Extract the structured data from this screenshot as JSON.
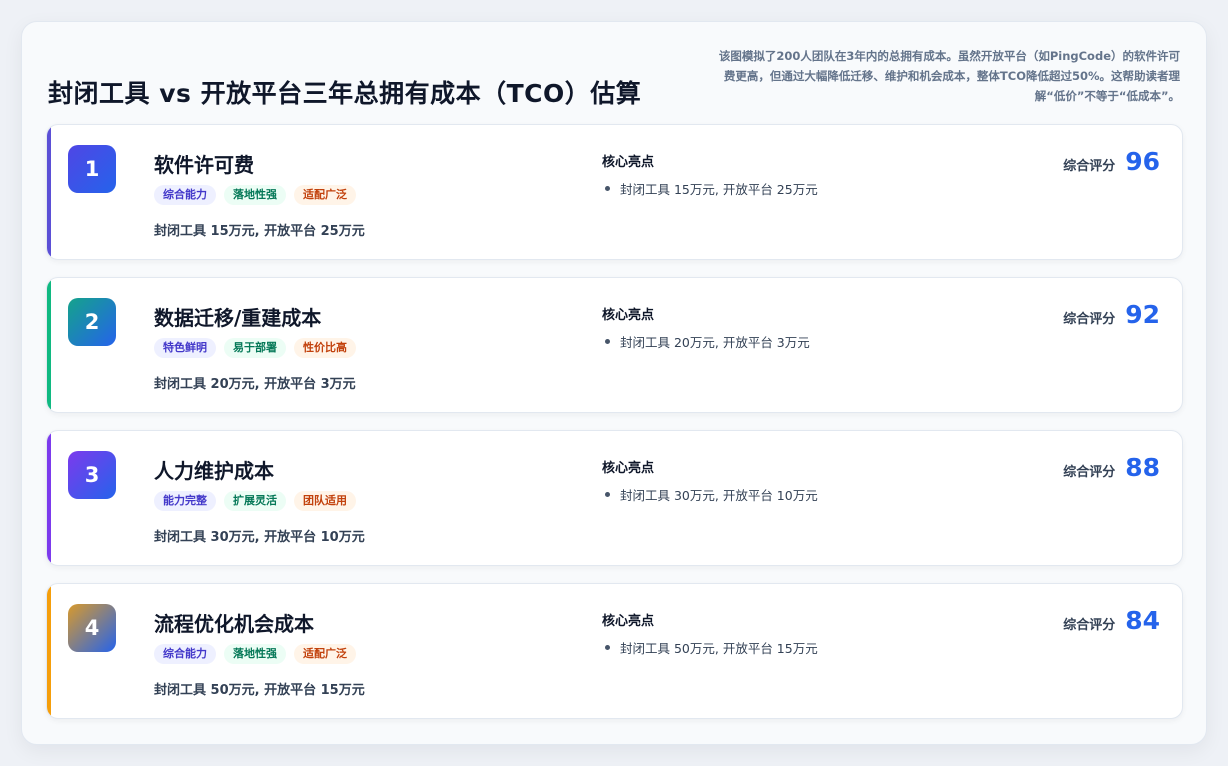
{
  "header": {
    "title": "封闭工具 vs 开放平台三年总拥有成本（TCO）估算",
    "description": "该图模拟了200人团队在3年内的总拥有成本。虽然开放平台（如PingCode）的软件许可费更高，但通过大幅降低迁移、维护和机会成本，整体TCO降低超过50%。这帮助读者理解“低价”不等于“低成本”。"
  },
  "highlight_label": "核心亮点",
  "score_label": "综合评分",
  "cards": [
    {
      "num": "1",
      "title": "软件许可费",
      "tags": [
        "综合能力",
        "落地性强",
        "适配广泛"
      ],
      "subtitle": "封闭工具 15万元, 开放平台 25万元",
      "highlight": "封闭工具 15万元, 开放平台 25万元",
      "score": "96",
      "accent": "#5b4fd6",
      "badge_gradient": [
        "#4f46e5",
        "#2563eb"
      ]
    },
    {
      "num": "2",
      "title": "数据迁移/重建成本",
      "tags": [
        "特色鲜明",
        "易于部署",
        "性价比高"
      ],
      "subtitle": "封闭工具 20万元, 开放平台 3万元",
      "highlight": "封闭工具 20万元, 开放平台 3万元",
      "score": "92",
      "accent": "#10b981",
      "badge_gradient": [
        "#14a38b",
        "#2563eb"
      ]
    },
    {
      "num": "3",
      "title": "人力维护成本",
      "tags": [
        "能力完整",
        "扩展灵活",
        "团队适用"
      ],
      "subtitle": "封闭工具 30万元, 开放平台 10万元",
      "highlight": "封闭工具 30万元, 开放平台 10万元",
      "score": "88",
      "accent": "#7c3aed",
      "badge_gradient": [
        "#7c3aed",
        "#2563eb"
      ]
    },
    {
      "num": "4",
      "title": "流程优化机会成本",
      "tags": [
        "综合能力",
        "落地性强",
        "适配广泛"
      ],
      "subtitle": "封闭工具 50万元, 开放平台 15万元",
      "highlight": "封闭工具 50万元, 开放平台 15万元",
      "score": "84",
      "accent": "#f59e0b",
      "badge_gradient": [
        "#d99a2b",
        "#2563eb"
      ]
    }
  ]
}
